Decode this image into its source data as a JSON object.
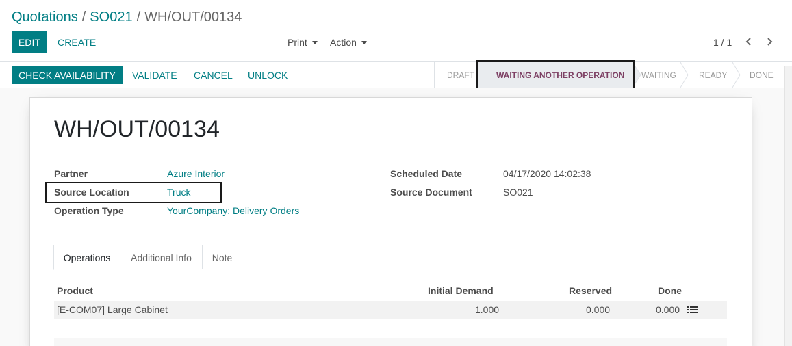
{
  "breadcrumb": {
    "items": [
      "Quotations",
      "SO021",
      "WH/OUT/00134"
    ],
    "separator": "/"
  },
  "toolbar": {
    "edit_label": "EDIT",
    "create_label": "CREATE",
    "print_label": "Print",
    "action_label": "Action"
  },
  "pager": {
    "value": "1 / 1",
    "prev_icon": "chevron-left-icon",
    "next_icon": "chevron-right-icon"
  },
  "status_bar": {
    "buttons": [
      "CHECK AVAILABILITY",
      "VALIDATE",
      "CANCEL",
      "UNLOCK"
    ],
    "stages": [
      "DRAFT",
      "WAITING ANOTHER OPERATION",
      "WAITING",
      "READY",
      "DONE"
    ],
    "active_stage": "WAITING ANOTHER OPERATION"
  },
  "record": {
    "title": "WH/OUT/00134",
    "left_fields": [
      {
        "label": "Partner",
        "value": "Azure Interior"
      },
      {
        "label": "Source Location",
        "value": "Truck"
      },
      {
        "label": "Operation Type",
        "value": "YourCompany: Delivery Orders"
      }
    ],
    "right_fields": [
      {
        "label": "Scheduled Date",
        "value": "04/17/2020 14:02:38"
      },
      {
        "label": "Source Document",
        "value": "SO021"
      }
    ]
  },
  "tabs": [
    "Operations",
    "Additional Info",
    "Note"
  ],
  "active_tab": "Operations",
  "operations_table": {
    "headers": [
      "Product",
      "Initial Demand",
      "Reserved",
      "Done"
    ],
    "rows": [
      {
        "product": "[E-COM07] Large Cabinet",
        "initial_demand": "1.000",
        "reserved": "0.000",
        "done": "0.000",
        "detail_icon": "list-icon"
      }
    ]
  },
  "colors": {
    "primary": "#017e84",
    "active_stage": "#7c3f63",
    "highlight_border": "#1a1a1a"
  }
}
